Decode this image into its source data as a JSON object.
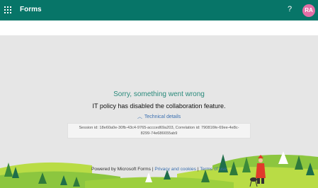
{
  "header": {
    "app_name": "Forms",
    "help_label": "?",
    "avatar_initials": "RA"
  },
  "error": {
    "heading": "Sorry, something went wrong",
    "message": "IT policy has disabled the collaboration feature.",
    "details_toggle": "Technical details",
    "session_line1": "Session id: 18e60a0e-30fb-43c4-9765-accced69a203, Correlation id: 790816fe-69ee-4e8c-",
    "session_line2": "8299-74e686655ab9"
  },
  "footer": {
    "powered": "Powered by Microsoft Forms |",
    "privacy_link": "Privacy and cookies",
    "sep": "|",
    "terms_link": "Terms of use"
  },
  "colors": {
    "header_bg": "#077568",
    "heading": "#2a8a7b",
    "link": "#3a6fb0",
    "avatar": "#e36fa6"
  }
}
